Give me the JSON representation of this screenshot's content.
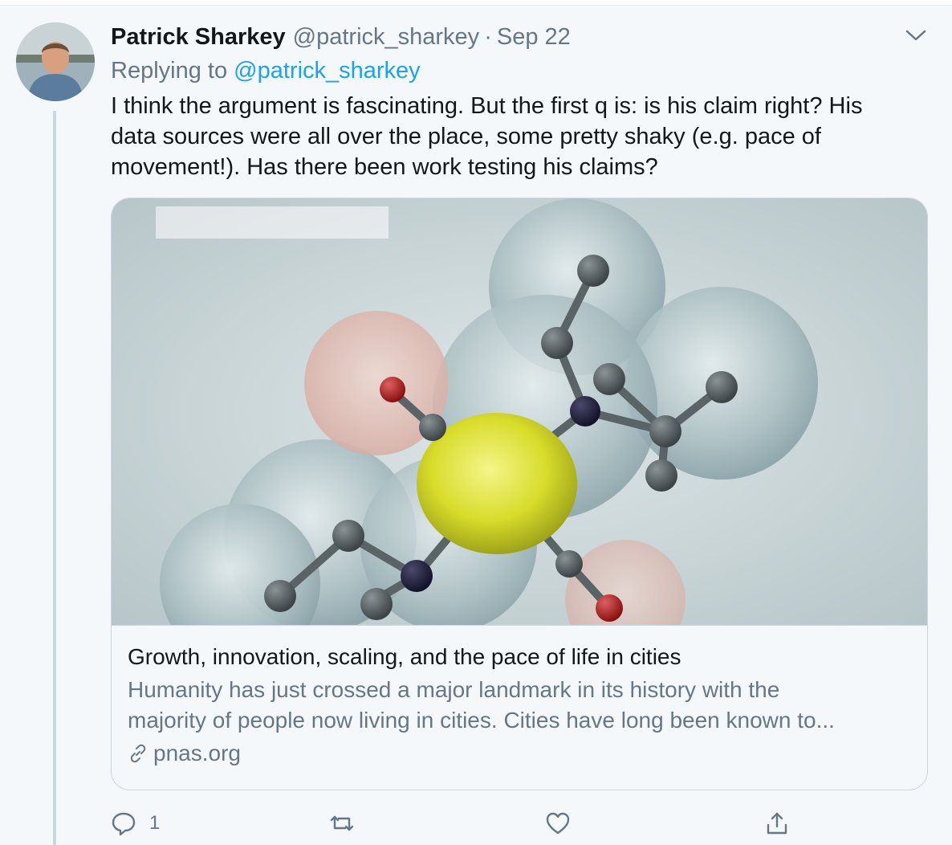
{
  "tweet": {
    "author_name": "Patrick Sharkey",
    "author_handle": "@patrick_sharkey",
    "separator": "·",
    "date": "Sep 22",
    "replying_prefix": "Replying to",
    "replying_to": "@patrick_sharkey",
    "text_lines": [
      "I think the argument is fascinating. But the first q is: is his claim right? His",
      "data sources were all over the place, some pretty shaky (e.g. pace of",
      "movement!). Has there been work testing his claims?"
    ]
  },
  "card": {
    "image_icon": "molecule-illustration",
    "title": "Growth, innovation, scaling, and the pace of life in cities",
    "description_lines": [
      "Humanity has just crossed a major landmark in its history with the",
      "majority of people now living in cities. Cities have long been known to..."
    ],
    "domain": "pnas.org",
    "domain_icon": "link-icon"
  },
  "actions": {
    "reply_icon": "reply-icon",
    "reply_count": "1",
    "retweet_icon": "retweet-icon",
    "like_icon": "heart-icon",
    "share_icon": "share-icon"
  },
  "colors": {
    "background": "#f5f8fa",
    "text_primary": "#14171a",
    "text_secondary": "#657786",
    "link": "#1da1f2",
    "border": "#ccd6dd"
  }
}
